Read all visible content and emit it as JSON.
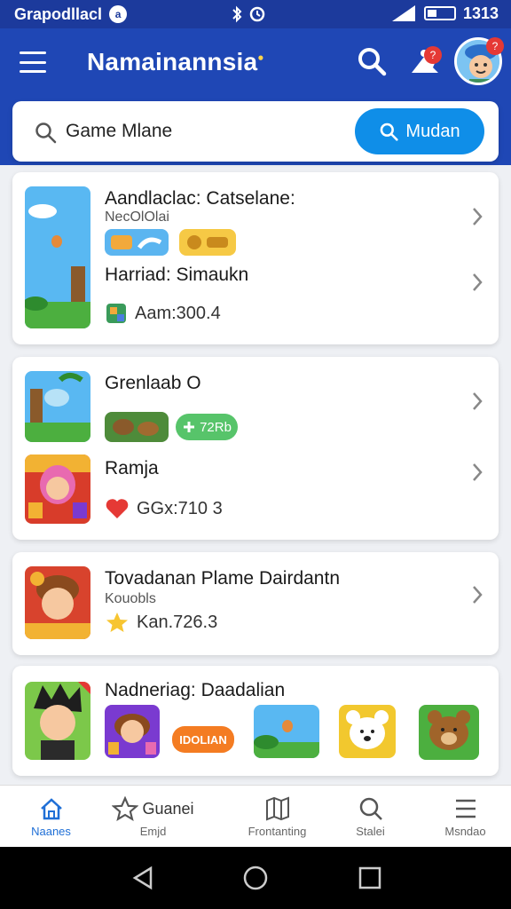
{
  "status": {
    "carrier": "Grapodllacl",
    "time": "1313"
  },
  "appbar": {
    "title": "Namainannsia",
    "notification_count": "?",
    "avatar_badge": "?"
  },
  "search": {
    "placeholder": "Game Mlane",
    "button_label": "Mudan"
  },
  "cards": [
    {
      "title": "Aandlaclac: Catselane:",
      "subtitle": "NecOlOlai",
      "title2": "Harriad: Simaukn",
      "meta": "Aam:300.4"
    },
    {
      "title": "Grenlaab O",
      "pill_label": "72Rb",
      "title2": "Ramja",
      "meta": "GGx:710 3"
    },
    {
      "title": "Tovadanan Plame Dairdantn",
      "subtitle": "Kouobls",
      "meta": "Kan.726.3"
    },
    {
      "title": "Nadneriag: Daadalian",
      "pill_label": "IDOLIAN"
    }
  ],
  "bottom_nav": [
    {
      "label": "Naanes",
      "icon": "home-icon",
      "active": true
    },
    {
      "label": "Emjd",
      "icon": "star-icon",
      "extra": "Guanei"
    },
    {
      "label": "Frontanting",
      "icon": "map-icon"
    },
    {
      "label": "Stalei",
      "icon": "search-icon"
    },
    {
      "label": "Msndao",
      "icon": "menu-icon"
    }
  ],
  "colors": {
    "primary": "#1f47b5",
    "accent": "#0f8ee8",
    "heart": "#e53935",
    "star": "#f7c531"
  }
}
